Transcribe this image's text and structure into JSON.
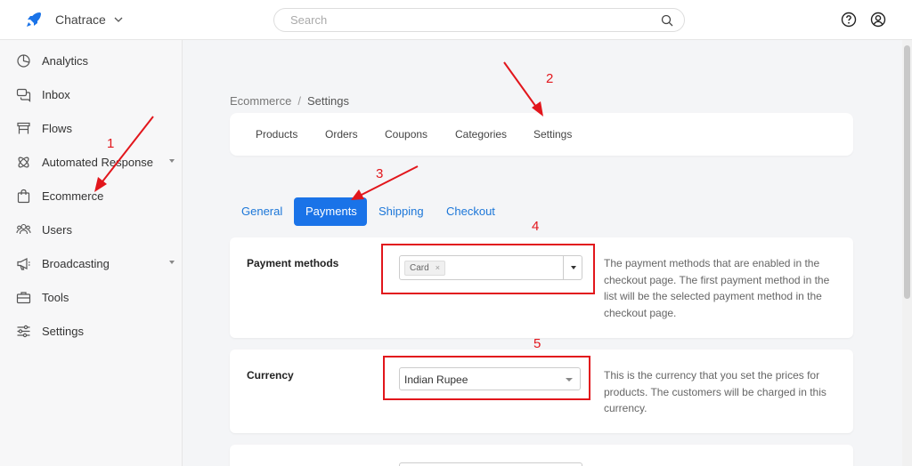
{
  "header": {
    "workspace": "Chatrace",
    "search_placeholder": "Search"
  },
  "sidebar": {
    "items": [
      {
        "label": "Analytics",
        "icon": "analytics-icon"
      },
      {
        "label": "Inbox",
        "icon": "inbox-icon"
      },
      {
        "label": "Flows",
        "icon": "flows-icon"
      },
      {
        "label": "Automated Response",
        "icon": "automated-response-icon",
        "has_caret": true
      },
      {
        "label": "Ecommerce",
        "icon": "ecommerce-bag-icon"
      },
      {
        "label": "Users",
        "icon": "users-icon"
      },
      {
        "label": "Broadcasting",
        "icon": "broadcast-megaphone-icon",
        "has_caret": true
      },
      {
        "label": "Tools",
        "icon": "tools-briefcase-icon"
      },
      {
        "label": "Settings",
        "icon": "settings-sliders-icon"
      }
    ]
  },
  "breadcrumb": {
    "parent": "Ecommerce",
    "separator": "/",
    "current": "Settings"
  },
  "subnav": {
    "items": [
      "Products",
      "Orders",
      "Coupons",
      "Categories",
      "Settings"
    ]
  },
  "tabs": {
    "items": [
      "General",
      "Payments",
      "Shipping",
      "Checkout"
    ],
    "active": "Payments"
  },
  "payment_methods": {
    "title": "Payment methods",
    "selected_chip": "Card",
    "chip_remove": "×",
    "description": "The payment methods that are enabled in the checkout page. The first payment method in the list will be the selected payment method in the checkout page."
  },
  "currency": {
    "title": "Currency",
    "value": "Indian Rupee",
    "description": "This is the currency that you set the prices for products. The customers will be charged in this currency."
  },
  "annotations": {
    "color": "#e2161c",
    "labels": [
      "1",
      "2",
      "3",
      "4",
      "5"
    ]
  },
  "colors": {
    "accent": "#1a73e8",
    "link": "#1b76d8",
    "brand": "#1a73e8"
  }
}
